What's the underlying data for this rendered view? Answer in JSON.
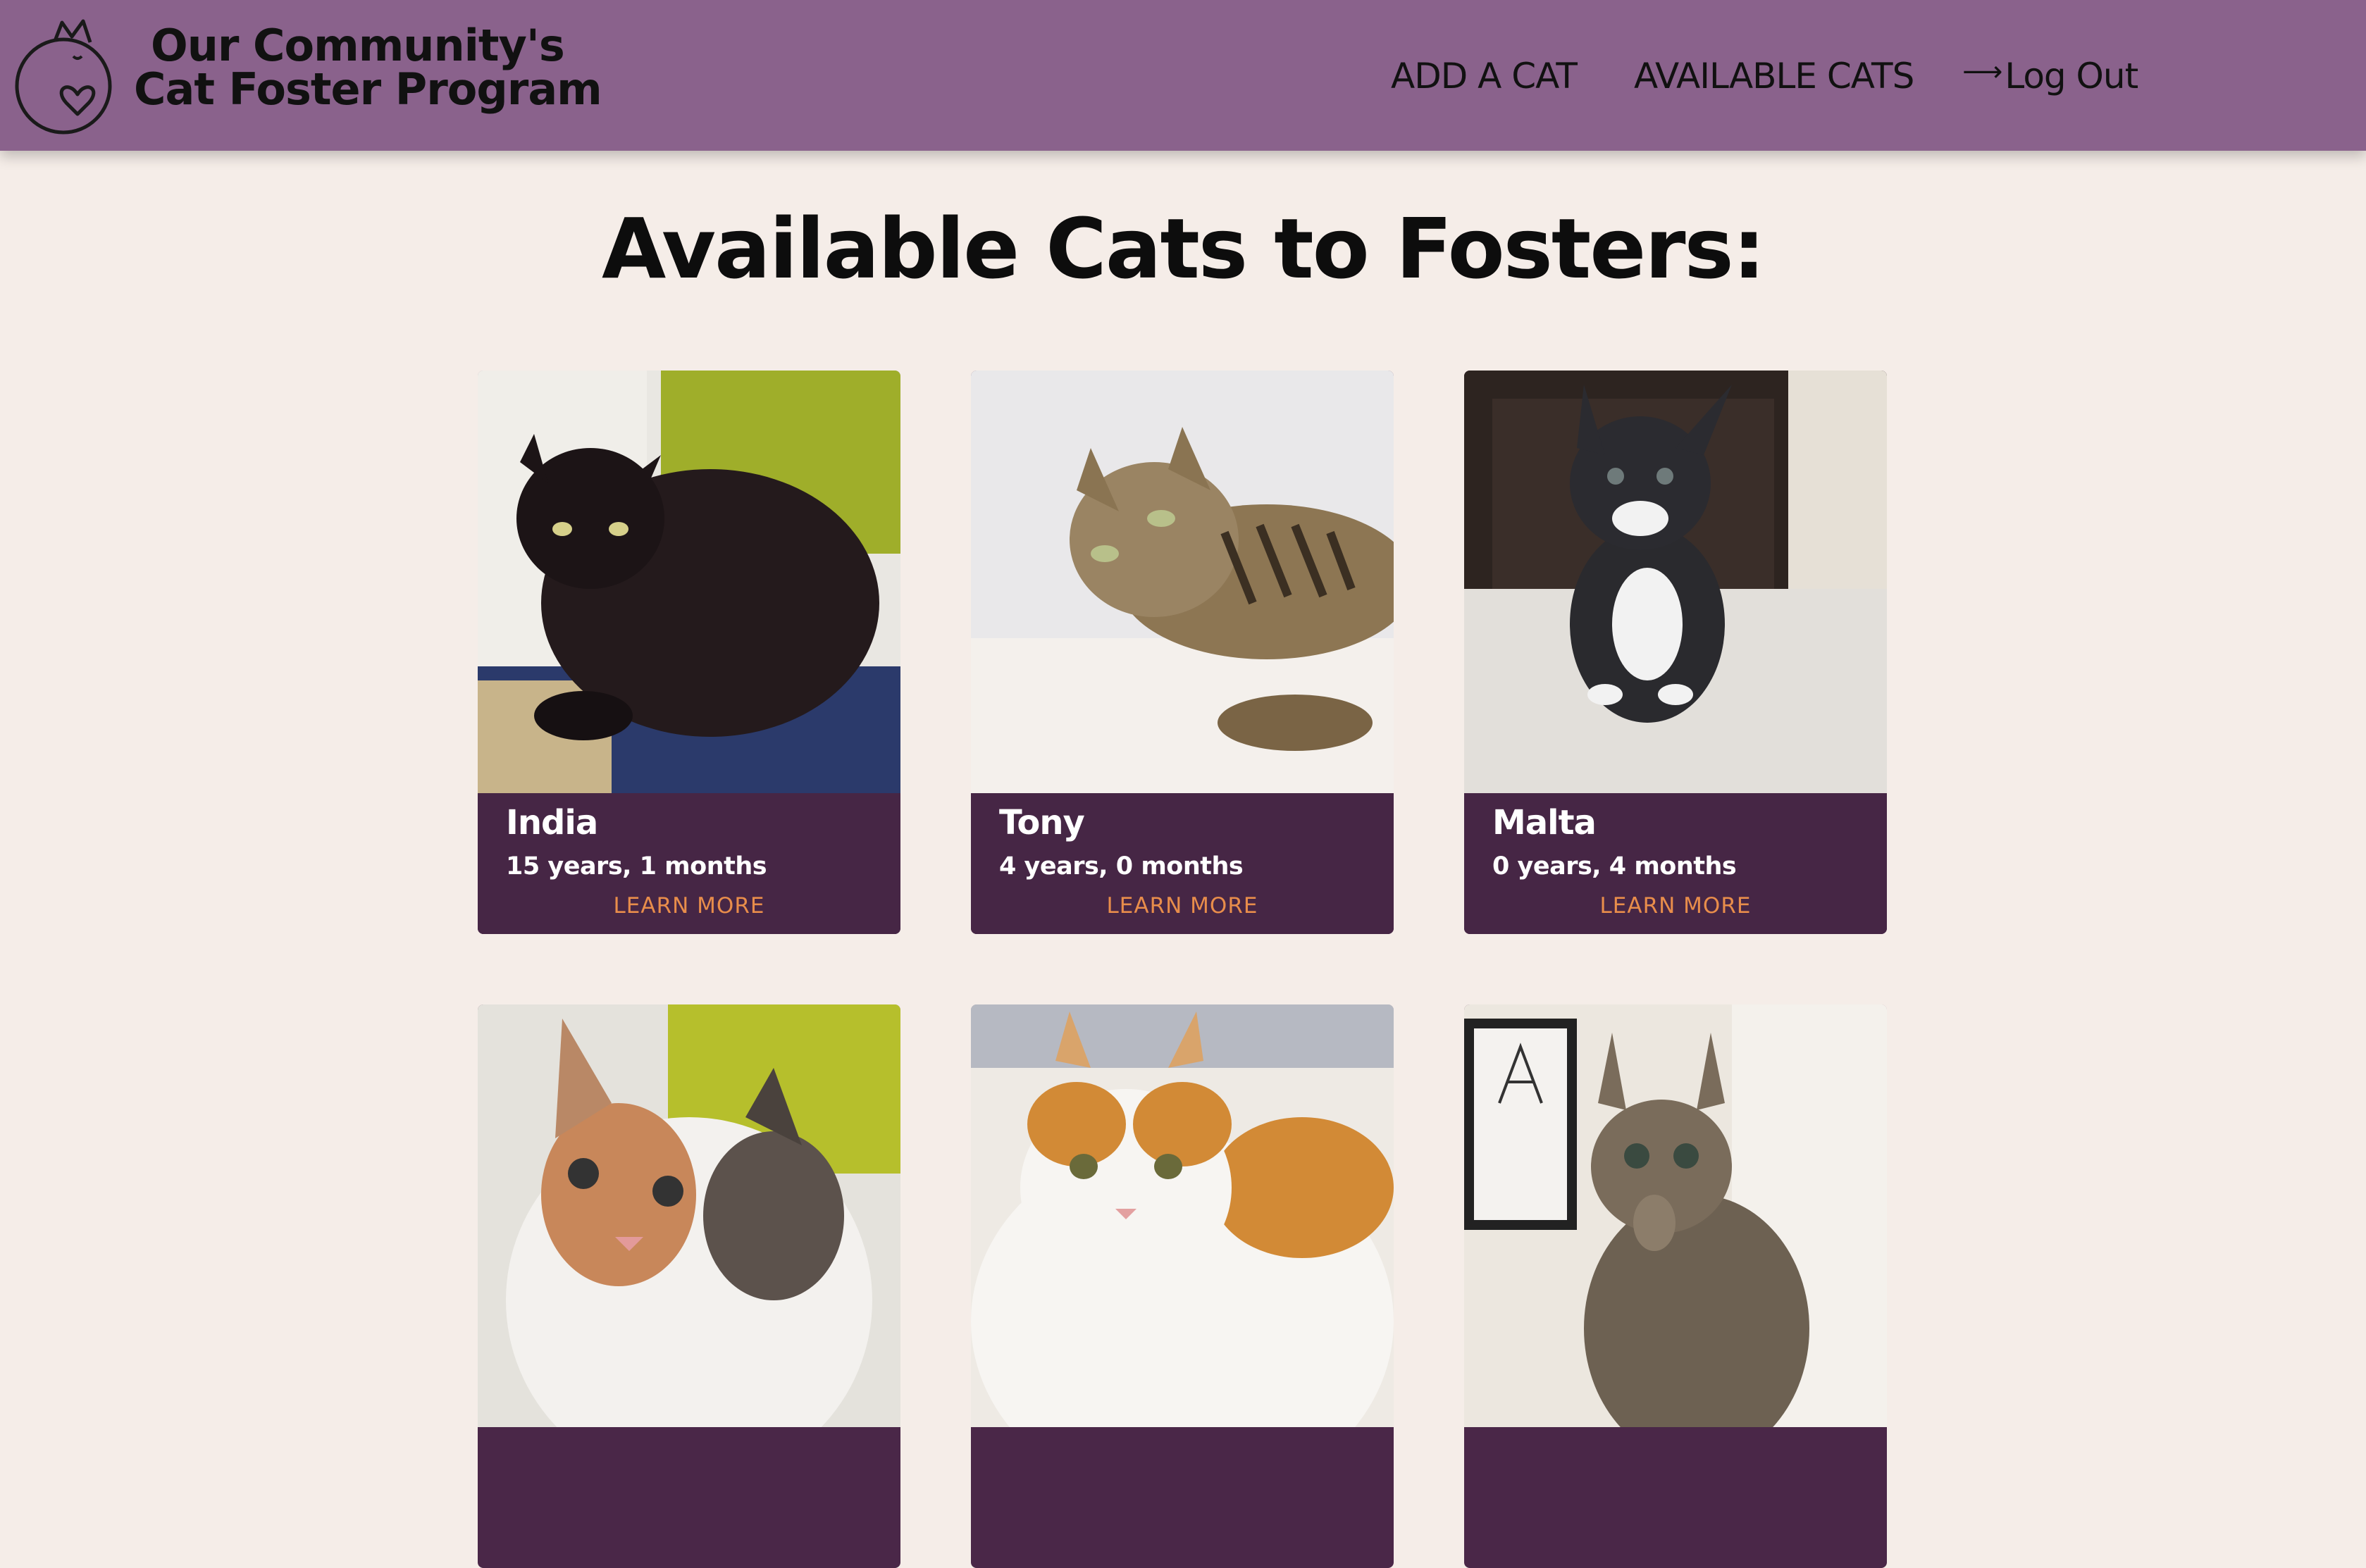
{
  "header": {
    "brand_line1": "Our Community's",
    "brand_line2": "Cat Foster Program",
    "nav": {
      "add_cat": "ADD A CAT",
      "available_cats": "AVAILABLE CATS",
      "logout": "Log Out",
      "logout_icon": "logout-arrow-icon"
    },
    "logo_icon": "cat-heart-logo-icon"
  },
  "main": {
    "title": "Available Cats to Fosters:",
    "cats": [
      {
        "name": "India",
        "age": "15 years, 1 months",
        "cta": "LEARN MORE"
      },
      {
        "name": "Tony",
        "age": "4 years, 0 months",
        "cta": "LEARN MORE"
      },
      {
        "name": "Malta",
        "age": "0 years, 4 months",
        "cta": "LEARN MORE"
      }
    ]
  },
  "colors": {
    "header_bg": "#8a628c",
    "page_bg": "#f5ede8",
    "card_bg": "#462645",
    "accent": "#e88d4b"
  }
}
